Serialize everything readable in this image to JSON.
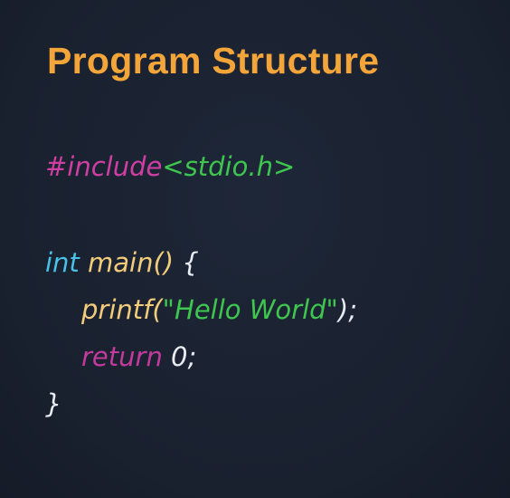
{
  "slide": {
    "title": "Program Structure"
  },
  "code": {
    "line1": {
      "directive": "#include",
      "header": "<stdio.h>"
    },
    "line2": {
      "type": "int",
      "space": " ",
      "func": "main()",
      "brace": " {"
    },
    "line3": {
      "func": "printf(",
      "string": "\"Hello World\"",
      "end": ");"
    },
    "line4": {
      "keyword": "return",
      "space": " ",
      "value": "0",
      "end": ";"
    },
    "line5": {
      "brace": "}"
    }
  },
  "colors": {
    "background": "#1b2333",
    "title": "#f3a53a",
    "preprocessor": "#cf3fa3",
    "header": "#3ec64f",
    "type": "#47c2e6",
    "function": "#f2cc7a",
    "string": "#3ec64f",
    "keyword": "#c23a9d",
    "plain": "#e8ecf2"
  }
}
